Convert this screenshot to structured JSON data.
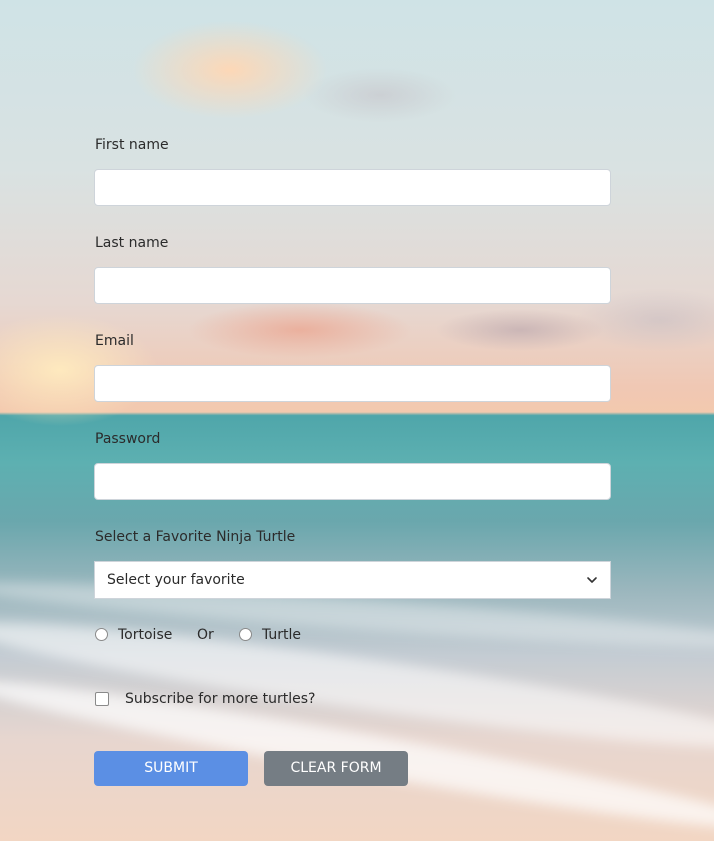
{
  "form": {
    "first_name": {
      "label": "First name",
      "value": ""
    },
    "last_name": {
      "label": "Last name",
      "value": ""
    },
    "email": {
      "label": "Email",
      "value": ""
    },
    "password": {
      "label": "Password",
      "value": ""
    },
    "favorite": {
      "label": "Select a Favorite Ninja Turtle",
      "selected": "Select your favorite"
    },
    "radio": {
      "option1": "Tortoise",
      "separator": "Or",
      "option2": "Turtle"
    },
    "subscribe_label": "Subscribe for more turtles?",
    "submit_label": "SUBMIT",
    "clear_label": "CLEAR FORM"
  },
  "colors": {
    "submit": "#5b8fe4",
    "clear": "#757d84"
  }
}
